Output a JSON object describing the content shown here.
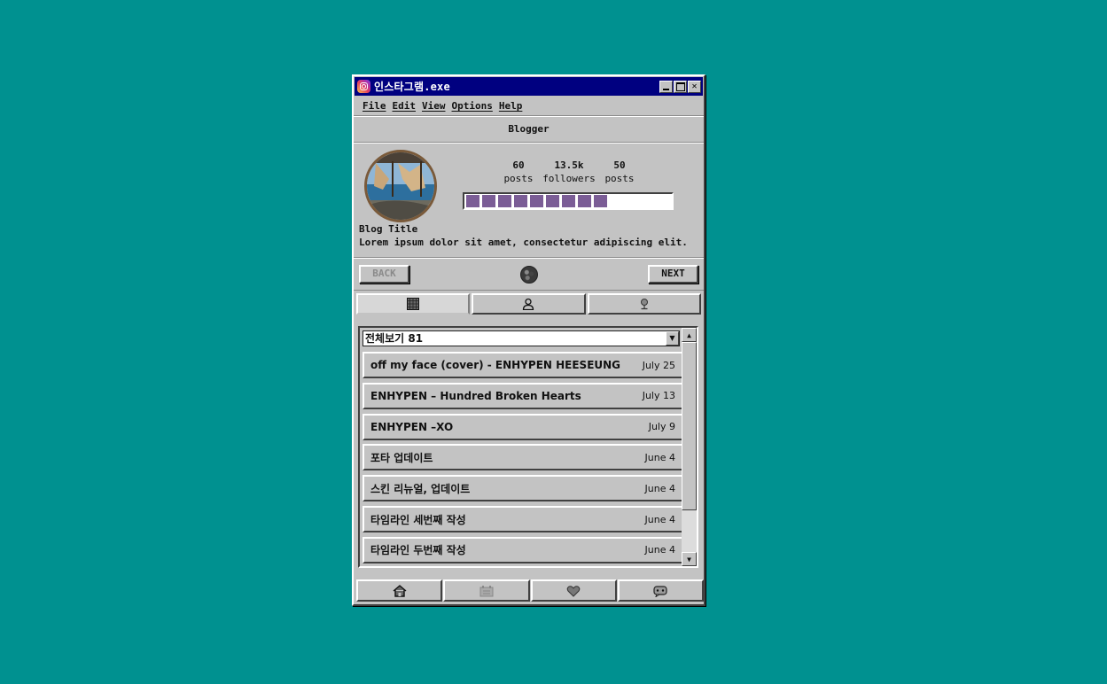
{
  "window": {
    "title": "인스타그램.exe"
  },
  "menu": [
    "File",
    "Edit",
    "View",
    "Options",
    "Help"
  ],
  "section_title": "Blogger",
  "stats": [
    {
      "value": "60",
      "label": "posts"
    },
    {
      "value": "13.5k",
      "label": "followers"
    },
    {
      "value": "50",
      "label": "posts"
    }
  ],
  "progress": {
    "filled_segments": 9,
    "fraction": 0.72
  },
  "blog": {
    "title": "Blog Title",
    "description": "Lorem ipsum dolor sit amet, consectetur adipiscing elit."
  },
  "nav": {
    "back": "BACK",
    "next": "NEXT"
  },
  "tabs": [
    "grid-icon",
    "person-icon",
    "pin-icon"
  ],
  "dropdown": {
    "selected": "전체보기 81"
  },
  "posts": [
    {
      "title": "off my face (cover) - ENHYPEN HEESEUNG",
      "date": "July 25"
    },
    {
      "title": "ENHYPEN – Hundred Broken Hearts",
      "date": "July 13"
    },
    {
      "title": "ENHYPEN –XO",
      "date": "July 9"
    },
    {
      "title": "포타 업데이트",
      "date": "June 4"
    },
    {
      "title": "스킨 리뉴얼, 업데이트",
      "date": "June 4"
    },
    {
      "title": "타임라인 세번째 작성",
      "date": "June 4"
    },
    {
      "title": "타임라인 두번째 작성",
      "date": "June 4"
    }
  ],
  "bottom_nav": [
    "home-icon",
    "calendar-icon",
    "heart-icon",
    "chat-icon"
  ],
  "colors": {
    "desktop": "#009190",
    "titlebar": "#000080",
    "progress": "#7b5d96",
    "window": "#c3c3c3"
  }
}
